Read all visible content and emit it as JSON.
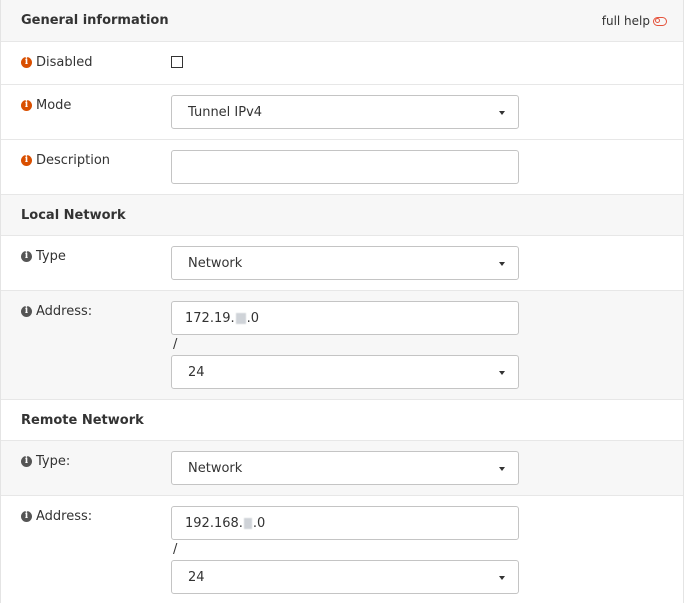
{
  "general": {
    "title": "General information",
    "full_help": "full help"
  },
  "disabled": {
    "label": "Disabled",
    "checked": false
  },
  "mode": {
    "label": "Mode",
    "value": "Tunnel IPv4"
  },
  "description": {
    "label": "Description",
    "value": ""
  },
  "local": {
    "title": "Local Network",
    "type_label": "Type",
    "type_value": "Network",
    "address_label": "Address:",
    "address_prefix": "172.19.",
    "address_suffix": ".0",
    "slash": "/",
    "mask_value": "24"
  },
  "remote": {
    "title": "Remote Network",
    "type_label": "Type:",
    "type_value": "Network",
    "address_label": "Address:",
    "address_prefix": "192.168.",
    "address_suffix": ".0",
    "slash": "/",
    "mask_value": "24"
  },
  "icons": {
    "info_orange": "info-circle-orange",
    "info_gray": "info-circle-gray",
    "help_toggle": "toggle-off"
  },
  "colors": {
    "info_orange": "#d94f00",
    "toggle": "#e5533c",
    "alt_row": "#f7f7f7"
  }
}
